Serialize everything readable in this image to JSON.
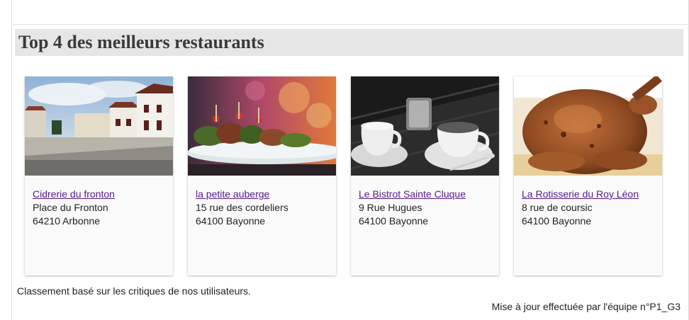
{
  "section": {
    "title": "Top 4 des meilleurs restaurants"
  },
  "restaurants": [
    {
      "name": "Cidrerie du fronton",
      "address": "Place du Fronton",
      "city": "64210 Arbonne"
    },
    {
      "name": "la petite auberge",
      "address": "15 rue des cordeliers",
      "city": "64100 Bayonne"
    },
    {
      "name": "Le Bistrot Sainte Cluque",
      "address": "9 Rue Hugues",
      "city": "64100 Bayonne"
    },
    {
      "name": "La Rotisserie du Roy Léon",
      "address": "8 rue de coursic",
      "city": "64100 Bayonne"
    }
  ],
  "footer": {
    "note": "Classement basé sur les critiques de nos utilisateurs.",
    "update": "Mise à jour effectuée par l'équipe n°P1_G3"
  },
  "colors": {
    "link_visited": "#551a8b",
    "title_bar": "#e6e6e6",
    "card_bg": "#fafafa"
  }
}
